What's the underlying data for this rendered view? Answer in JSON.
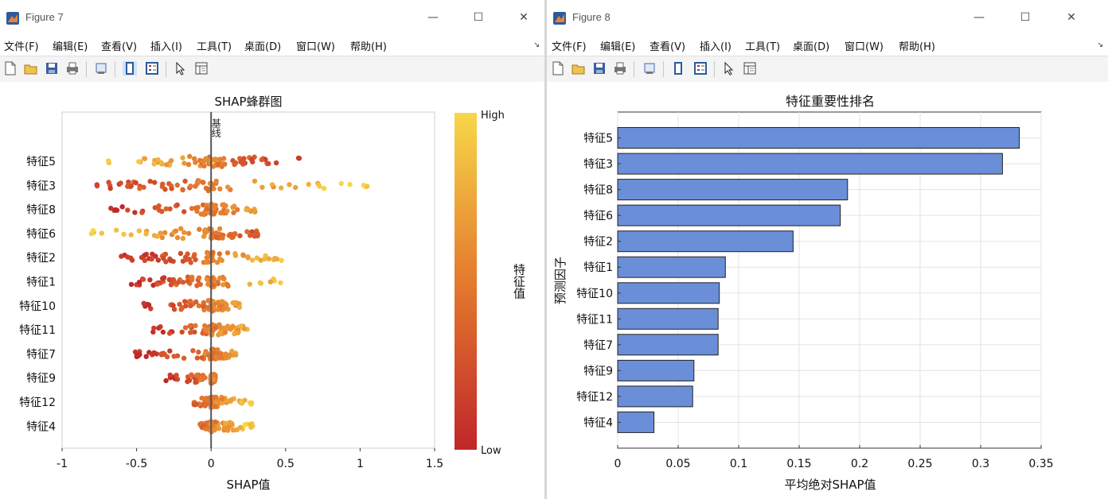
{
  "menu_items": [
    "文件(F)",
    "编辑(E)",
    "查看(V)",
    "插入(I)",
    "工具(T)",
    "桌面(D)",
    "窗口(W)",
    "帮助(H)"
  ],
  "window_controls": {
    "minimize": "—",
    "maximize": "☐",
    "close": "✕"
  },
  "toolbar_icons": [
    "new-figure-icon",
    "open-file-icon",
    "save-icon",
    "print-icon",
    "link-plot-icon",
    "colorbar-icon",
    "legend-icon",
    "pointer-icon",
    "property-inspector-icon"
  ],
  "colors": {
    "bar": "#6a8fd8",
    "low": "#c0262a",
    "high": "#f7d748",
    "baseline": "#555555"
  },
  "fig7": {
    "title": "Figure 7",
    "chart_data": {
      "type": "scatter",
      "subtype": "beeswarm",
      "title": "SHAP蜂群图",
      "xlabel": "SHAP值",
      "ylabel": "",
      "xlim": [
        -1,
        1.5
      ],
      "xticks": [
        -1,
        -0.5,
        0,
        0.5,
        1,
        1.5
      ],
      "categories": [
        "特征5",
        "特征3",
        "特征8",
        "特征6",
        "特征2",
        "特征1",
        "特征10",
        "特征11",
        "特征7",
        "特征9",
        "特征12",
        "特征4"
      ],
      "baseline_label": "基线",
      "baseline_x": 0,
      "colorbar": {
        "label": "特征值",
        "high": "High",
        "low": "Low"
      },
      "spread": [
        {
          "feature": "特征5",
          "lo": -0.72,
          "hi": 0.7,
          "low_value_side": "positive"
        },
        {
          "feature": "特征3",
          "lo": -0.82,
          "hi": 1.08,
          "low_value_side": "negative"
        },
        {
          "feature": "特征8",
          "lo": -0.7,
          "hi": 0.3,
          "low_value_side": "negative"
        },
        {
          "feature": "特征6",
          "lo": -0.9,
          "hi": 0.33,
          "low_value_side": "positive"
        },
        {
          "feature": "特征2",
          "lo": -0.62,
          "hi": 0.5,
          "low_value_side": "negative"
        },
        {
          "feature": "特征1",
          "lo": -0.58,
          "hi": 0.47,
          "low_value_side": "negative"
        },
        {
          "feature": "特征10",
          "lo": -0.46,
          "hi": 0.2,
          "low_value_side": "negative"
        },
        {
          "feature": "特征11",
          "lo": -0.42,
          "hi": 0.3,
          "low_value_side": "negative"
        },
        {
          "feature": "特征7",
          "lo": -0.52,
          "hi": 0.18,
          "low_value_side": "negative"
        },
        {
          "feature": "特征9",
          "lo": -0.32,
          "hi": 0.03,
          "low_value_side": "negative"
        },
        {
          "feature": "特征12",
          "lo": -0.12,
          "hi": 0.3,
          "low_value_side": "negative"
        },
        {
          "feature": "特征4",
          "lo": -0.1,
          "hi": 0.3,
          "low_value_side": "negative"
        }
      ]
    }
  },
  "fig8": {
    "title": "Figure 8",
    "chart_data": {
      "type": "bar",
      "orientation": "horizontal",
      "title": "特征重要性排名",
      "xlabel": "平均绝对SHAP值",
      "ylabel": "预测因子",
      "xlim": [
        0,
        0.35
      ],
      "xticks": [
        0,
        0.05,
        0.1,
        0.15,
        0.2,
        0.25,
        0.3,
        0.35
      ],
      "grid": true,
      "categories": [
        "特征5",
        "特征3",
        "特征8",
        "特征6",
        "特征2",
        "特征1",
        "特征10",
        "特征11",
        "特征7",
        "特征9",
        "特征12",
        "特征4"
      ],
      "values": [
        0.332,
        0.318,
        0.19,
        0.184,
        0.145,
        0.089,
        0.084,
        0.083,
        0.083,
        0.063,
        0.062,
        0.03
      ]
    }
  }
}
